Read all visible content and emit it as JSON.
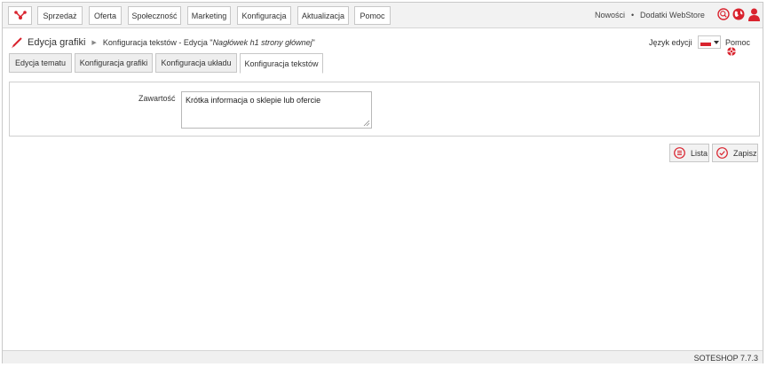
{
  "nav": {
    "items": [
      "Sprzedaż",
      "Oferta",
      "Społeczność",
      "Marketing",
      "Konfiguracja",
      "Aktualizacja",
      "Pomoc"
    ],
    "links": {
      "news": "Nowości",
      "separator": "•",
      "addons": "Dodatki WebStore"
    }
  },
  "breadcrumb": {
    "section": "Edycja grafiki",
    "page_prefix": "Konfiguracja tekstów - Edycja \"",
    "page_item": "Nagłówek h1 strony głównej",
    "page_suffix": "\""
  },
  "header": {
    "language_label": "Język edycji",
    "help_label": "Pomoc"
  },
  "tabs": [
    "Edycja tematu",
    "Konfiguracja grafiki",
    "Konfiguracja układu",
    "Konfiguracja tekstów"
  ],
  "active_tab": "Konfiguracja tekstów",
  "form": {
    "content_label": "Zawartość",
    "content_value": "Krótka informacja o sklepie lub ofercie"
  },
  "actions": {
    "list_label": "Lista",
    "save_label": "Zapisz"
  },
  "footer": {
    "version": "SOTESHOP 7.7.3"
  },
  "colors": {
    "accent": "#d9232e",
    "nav_bg": "#f2f2f2",
    "border": "#c7c7c7"
  },
  "icons": [
    "logo-icon",
    "search-icon",
    "globe-icon",
    "user-icon",
    "brush-icon",
    "flag-pl-icon",
    "help-icon",
    "list-icon",
    "check-icon"
  ]
}
